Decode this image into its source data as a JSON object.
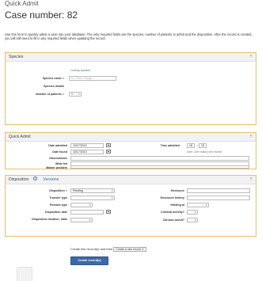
{
  "page": {
    "title": "Quick Admit",
    "case_heading": "Case number: 82",
    "intro": "Use this form to quickly admit a case into your database. The only required fields are the species, number of patients to admit and the disposition. After the record is created, you will still need to fill in any required fields when updating the record."
  },
  "species_panel": {
    "header": "Species",
    "lookup_link": "Lookup species",
    "species_name_label": "Species name",
    "species_name_placeholder": "ex. Finch, House",
    "species_details_label": "Species details",
    "num_patients_label": "Number of patients",
    "num_patients_value": "1"
  },
  "quickadmit_panel": {
    "header": "Quick Admit",
    "date_admitted_label": "Date admitted",
    "date_admitted_value": "10/17/2013",
    "time_admitted_label": "Time admitted",
    "time_hour": "18",
    "time_minute": "15",
    "date_found_label": "Date found",
    "date_found_value": "10/17/2013",
    "time_note": "Note: 24hr military time format",
    "observations_label": "Observations",
    "what_fed_label": "What fed",
    "master_problem_label": "Master problem"
  },
  "disposition_panel": {
    "header": "Disposition",
    "versions_link": "Versions",
    "disposition_label": "Disposition",
    "disposition_value": "Pending",
    "enclosure_label": "Enclosure",
    "transfer_type_label": "Transfer type",
    "enclosure_history_label": "Enclosure history",
    "release_type_label": "Release type",
    "holding_at_label": "Holding at",
    "disposition_date_label": "Disposition date",
    "criminal_activity_label": "Criminal activity?",
    "disposition_location_label": "Disposition location, state",
    "carcass_saved_label": "Carcass saved?"
  },
  "footer": {
    "create_prefix": "Create this record(s) and then",
    "create_option": "Create a new record",
    "create_button": "Create record(s)"
  },
  "colors": {
    "panel_border": "#e6c06a",
    "required": "#d6403a",
    "link": "#3a6fb0",
    "button": "#3b6aa6"
  },
  "icons": [
    "calendar-icon",
    "grip-icon",
    "clock-icon"
  ]
}
